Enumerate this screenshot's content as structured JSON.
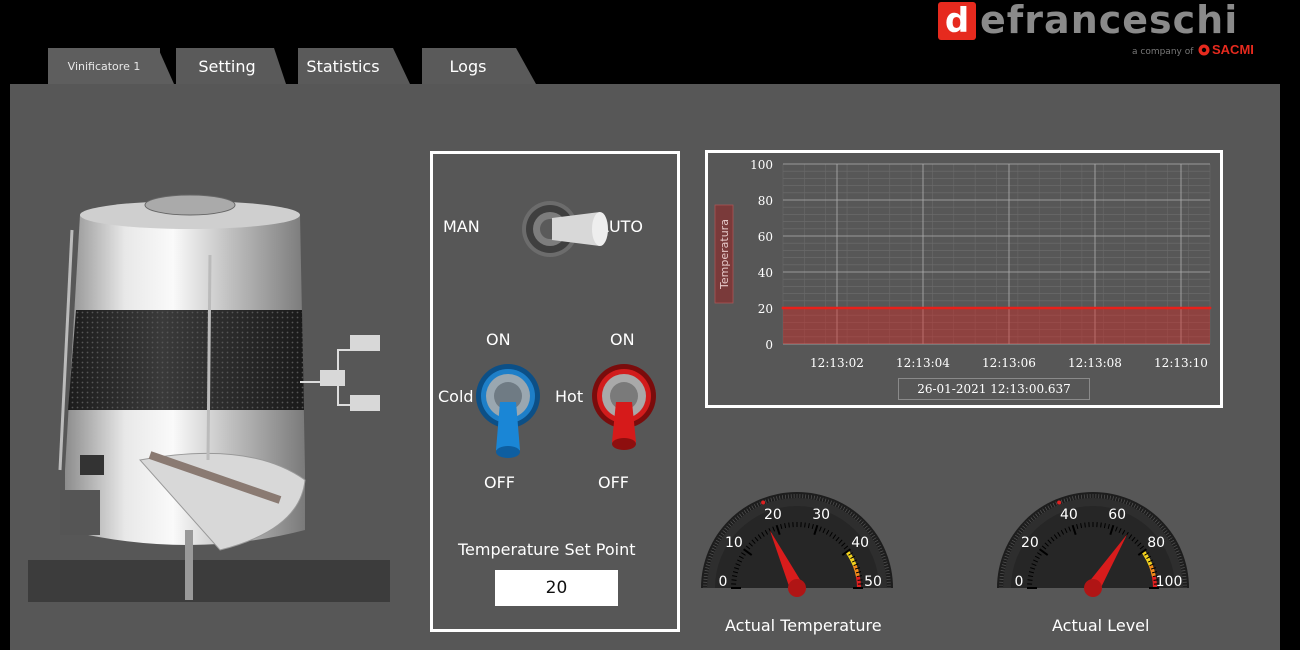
{
  "tabs": [
    {
      "label": "Vinificatore 1",
      "active": true
    },
    {
      "label": "Setting",
      "active": false
    },
    {
      "label": "Statistics",
      "active": false
    },
    {
      "label": "Logs",
      "active": false
    }
  ],
  "brand": {
    "logo_letter": "d",
    "logo_rest": "efranceschi",
    "subtitle": "a company of",
    "parent": "SACMI",
    "accent": "#e62a1e"
  },
  "controls": {
    "mode_left": "MAN",
    "mode_right": "AUTO",
    "mode_state": "AUTO",
    "cold": {
      "label": "Cold",
      "on": "ON",
      "off": "OFF",
      "color": "#1e7fc8"
    },
    "hot": {
      "label": "Hot",
      "on": "ON",
      "off": "OFF",
      "color": "#d21c1c"
    },
    "setpoint_label": "Temperature Set Point",
    "setpoint_value": "20"
  },
  "chart_data": {
    "type": "area",
    "ylabel": "Temperatura",
    "ylim": [
      0,
      100
    ],
    "yticks": [
      0,
      20,
      40,
      60,
      80,
      100
    ],
    "xtick_labels": [
      "12:13:02",
      "12:13:04",
      "12:13:06",
      "12:13:08",
      "12:13:10"
    ],
    "series": [
      {
        "values": [
          20,
          20,
          20,
          20,
          20,
          20,
          20,
          20,
          20,
          20,
          20
        ],
        "color": "#e8201a"
      }
    ],
    "timestamp": "26-01-2021  12:13:00.637",
    "grid": true
  },
  "gauges": [
    {
      "label": "Actual Temperature",
      "min": 0,
      "max": 50,
      "ticks": [
        0,
        10,
        20,
        30,
        40,
        50
      ],
      "value": 18
    },
    {
      "label": "Actual Level",
      "min": 0,
      "max": 100,
      "ticks": [
        0,
        20,
        40,
        60,
        80,
        100
      ],
      "value": 68
    }
  ]
}
